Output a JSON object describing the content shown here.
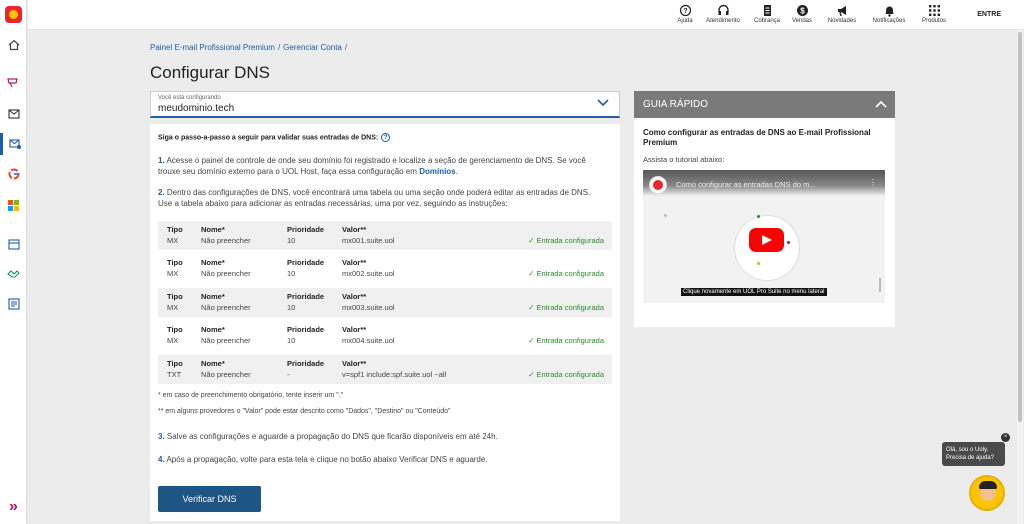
{
  "topbar": {
    "items": [
      {
        "label": "Ajuda",
        "icon": "help-icon"
      },
      {
        "label": "Atendimento",
        "icon": "headset-icon"
      },
      {
        "label": "Cobrança",
        "icon": "invoice-icon"
      },
      {
        "label": "Vendas",
        "icon": "dollar-icon"
      },
      {
        "label": "Novidades",
        "icon": "megaphone-icon"
      },
      {
        "label": "Notificações",
        "icon": "bell-icon"
      },
      {
        "label": "Produtos",
        "icon": "grid-icon"
      }
    ],
    "login_label": "ENTRE"
  },
  "breadcrumb": {
    "item1": "Painel E-mail Profissional Premium",
    "item2": "Gerenciar Conta",
    "sep": "/"
  },
  "page_title": "Configurar DNS",
  "domain_select": {
    "label": "Você está configurando",
    "value": "meudominio.tech"
  },
  "instructions": {
    "intro": "Siga o passo-a-passo a seguir para validar suas entradas de DNS:",
    "step1_num": "1.",
    "step1_text": "Acesse o painel de controle de onde seu domínio foi registrado e localize a seção de gerenciamento de DNS. Se você trouxe seu domínio externo para o UOL Host, faça essa configuração em ",
    "step1_link": "Domínios",
    "step2_num": "2.",
    "step2_text": "Dentro das configurações de DNS, você encontrará uma tabela ou uma seção onde poderá editar as entradas de DNS. Use a tabela abaixo para adicionar as entradas necessárias, uma por vez, seguindo as instruções:",
    "step3_num": "3.",
    "step3_text": "Salve as configurações e aguarde a propagação do DNS que ficarão disponíveis em até 24h.",
    "step4_num": "4.",
    "step4_text": "Após a propagação, volte para esta tela e clique no botão abaixo Verificar DNS e aguarde."
  },
  "dns_table": {
    "headers": {
      "type": "Tipo",
      "name": "Nome*",
      "priority": "Prioridade",
      "value": "Valor**"
    },
    "rows": [
      {
        "type": "MX",
        "name": "Não preencher",
        "priority": "10",
        "value": "mx001.suite.uol",
        "status": "✓ Entrada configurada"
      },
      {
        "type": "MX",
        "name": "Não preencher",
        "priority": "10",
        "value": "mx002.suite.uol",
        "status": "✓ Entrada configurada"
      },
      {
        "type": "MX",
        "name": "Não preencher",
        "priority": "10",
        "value": "mx003.suite.uol",
        "status": "✓ Entrada configurada"
      },
      {
        "type": "MX",
        "name": "Não preencher",
        "priority": "10",
        "value": "mx004.suite.uol",
        "status": "✓ Entrada configurada"
      },
      {
        "type": "TXT",
        "name": "Não preencher",
        "priority": "-",
        "value": "v=spf1 include:spf.suite.uol ~all",
        "status": "✓ Entrada configurada"
      }
    ]
  },
  "notes": {
    "note1": "* em caso de preenchimento obrigatório, tente inserir um \".\"",
    "note2": "** em alguns provedores o \"Valor\" pode estar descrito como \"Dados\", \"Destino\" ou \"Conteúdo\""
  },
  "verify_button": "Verificar DNS",
  "guide": {
    "header": "GUIA RÁPIDO",
    "title": "Como configurar as entradas de DNS ao E-mail Profissional Premium",
    "subtitle": "Assista o tutorial abaixo:",
    "video_title": "Como configurar as entradas DNS do m...",
    "video_caption": "Clique novamente em UOL Pro Suite no menu lateral"
  },
  "chat": {
    "bubble_line1": "Olá, sou o Uoly.",
    "bubble_line2": "Precisa de ajuda?",
    "close": "×"
  },
  "colors": {
    "accent": "#1c5fa8",
    "button": "#1d5585",
    "success": "#2b8a2b",
    "guide_header": "#7a7a7a"
  }
}
